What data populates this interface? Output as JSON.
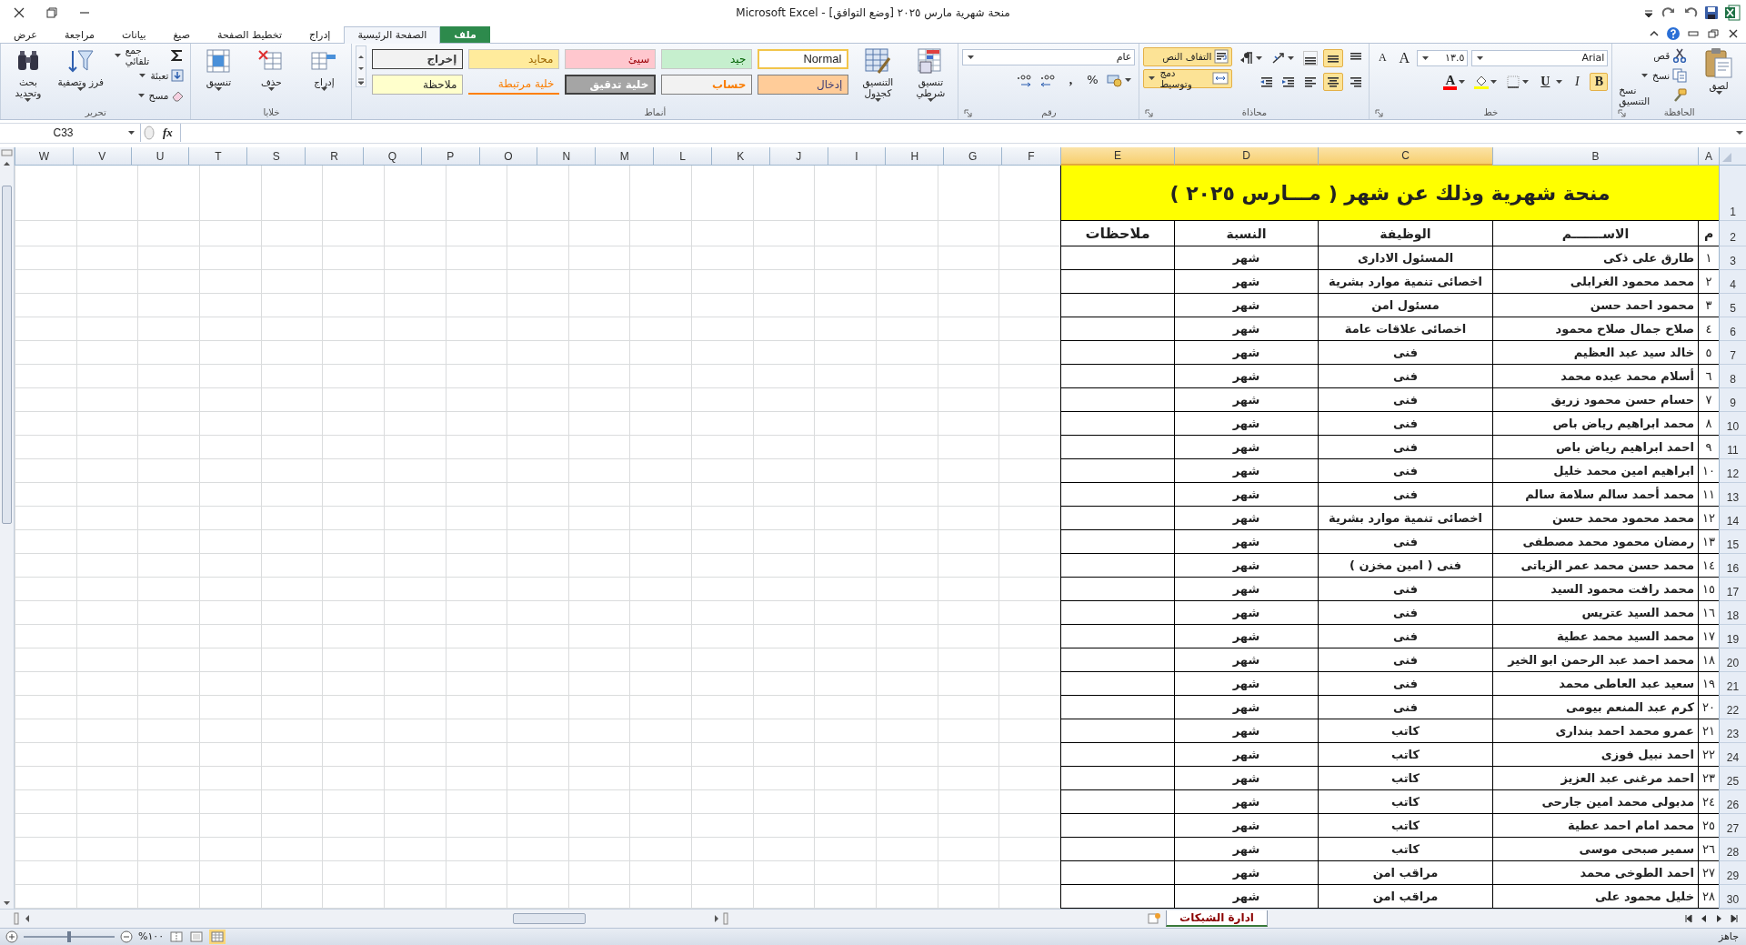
{
  "window": {
    "title": "منحة شهرية مارس ٢٠٢٥ [وضع التوافق] - Microsoft Excel"
  },
  "ribbon": {
    "tabs": [
      {
        "label": "ملف",
        "kind": "file",
        "selected": false
      },
      {
        "label": "الصفحة الرئيسية",
        "kind": "tab",
        "selected": true
      },
      {
        "label": "إدراج",
        "kind": "tab",
        "selected": false
      },
      {
        "label": "تخطيط الصفحة",
        "kind": "tab",
        "selected": false
      },
      {
        "label": "صيغ",
        "kind": "tab",
        "selected": false
      },
      {
        "label": "بيانات",
        "kind": "tab",
        "selected": false
      },
      {
        "label": "مراجعة",
        "kind": "tab",
        "selected": false
      },
      {
        "label": "عرض",
        "kind": "tab",
        "selected": false
      }
    ],
    "groups": [
      {
        "label": "الحافظة",
        "launcher": true,
        "items": [
          {
            "kind": "large",
            "label": "لصق",
            "dropdown": true
          },
          {
            "kind": "column",
            "items": [
              {
                "kind": "small",
                "label": "قص",
                "dropdown": false
              },
              {
                "kind": "small",
                "label": "نسخ",
                "dropdown": true
              },
              {
                "kind": "small",
                "label": "نسخ التنسيق",
                "dropdown": false
              }
            ]
          }
        ]
      },
      {
        "label": "خط",
        "launcher": true,
        "items": [
          {
            "kind": "toolbars",
            "bars": [
              {
                "items": [
                  {
                    "kind": "field",
                    "value": "Arial",
                    "dropdown": true
                  },
                  {
                    "kind": "field",
                    "value": "١٣.٥",
                    "dropdown": true
                  },
                  {
                    "kind": "grow",
                    "label": "A"
                  },
                  {
                    "kind": "shrink",
                    "label": "A"
                  }
                ]
              },
              {
                "items": [
                  {
                    "kind": "glyph",
                    "label": "B",
                    "selected": true
                  },
                  {
                    "kind": "glyph",
                    "label": "I",
                    "selected": false
                  },
                  {
                    "kind": "glyph",
                    "label": "U",
                    "selected": false,
                    "dropdown": true
                  },
                  {
                    "kind": "icon",
                    "selected": false,
                    "dropdown": true
                  },
                  {
                    "kind": "fill",
                    "color": "#ffff00",
                    "dropdown": true
                  },
                  {
                    "kind": "fontcolor",
                    "label": "A",
                    "color": "#ff0000",
                    "dropdown": true
                  }
                ]
              }
            ]
          }
        ]
      },
      {
        "label": "محاذاة",
        "launcher": true,
        "items": [
          {
            "kind": "toolbars",
            "bars": [
              {
                "items": [
                  {
                    "kind": "icon",
                    "selected": false
                  },
                  {
                    "kind": "icon",
                    "selected": true
                  },
                  {
                    "kind": "icon",
                    "selected": false
                  },
                  {
                    "kind": "icon",
                    "selected": false,
                    "dropdown": true
                  },
                  {
                    "kind": "icon",
                    "selected": false,
                    "dropdown": true
                  }
                ]
              },
              {
                "items": [
                  {
                    "kind": "icon",
                    "selected": false
                  },
                  {
                    "kind": "icon",
                    "selected": true
                  },
                  {
                    "kind": "icon",
                    "selected": false
                  },
                  {
                    "kind": "icon",
                    "selected": false
                  },
                  {
                    "kind": "icon",
                    "selected": false
                  }
                ]
              }
            ]
          },
          {
            "kind": "column",
            "items": [
              {
                "kind": "small",
                "label": "التفاف النص",
                "selected": true,
                "dropdown": false
              },
              {
                "kind": "small",
                "label": "دمج وتوسيط",
                "selected": true,
                "dropdown": true
              }
            ]
          }
        ]
      },
      {
        "label": "رقم",
        "launcher": true,
        "items": [
          {
            "kind": "toolbars",
            "bars": [
              {
                "items": [
                  {
                    "kind": "field",
                    "value": "عام",
                    "dropdown": true
                  }
                ]
              },
              {
                "items": [
                  {
                    "kind": "icon",
                    "selected": false,
                    "dropdown": true
                  },
                  {
                    "kind": "glyph",
                    "label": "%",
                    "selected": false
                  },
                  {
                    "kind": "glyph",
                    "label": ",",
                    "selected": false
                  },
                  {
                    "kind": "icon",
                    "selected": false
                  },
                  {
                    "kind": "icon",
                    "selected": false
                  }
                ]
              }
            ]
          }
        ]
      },
      {
        "label": "أنماط",
        "launcher": false,
        "items": [
          {
            "kind": "large",
            "label": "تنسيق شرطي",
            "dropdown": true
          },
          {
            "kind": "large",
            "label": "التنسيق كجدول",
            "dropdown": true
          },
          {
            "kind": "gallery",
            "items": [
              {
                "label": "Normal"
              },
              {
                "label": "جيد"
              },
              {
                "label": "سيئ"
              },
              {
                "label": "محايد"
              },
              {
                "label": "إخراج"
              },
              {
                "label": "إدخال"
              },
              {
                "label": "حساب"
              },
              {
                "label": "خلية تدقيق"
              },
              {
                "label": "خلية مرتبطة"
              },
              {
                "label": "ملاحظة"
              }
            ]
          }
        ]
      },
      {
        "label": "خلايا",
        "launcher": false,
        "items": [
          {
            "kind": "large",
            "label": "إدراج",
            "dropdown": true
          },
          {
            "kind": "large",
            "label": "حذف",
            "dropdown": true
          },
          {
            "kind": "large",
            "label": "تنسيق",
            "dropdown": true
          }
        ]
      },
      {
        "label": "تحرير",
        "launcher": false,
        "items": [
          {
            "kind": "column",
            "items": [
              {
                "kind": "small",
                "label": "جمع تلقائي",
                "dropdown": true
              },
              {
                "kind": "small",
                "label": "تعبئة",
                "dropdown": true
              },
              {
                "kind": "small",
                "label": "مسح",
                "dropdown": true
              }
            ]
          },
          {
            "kind": "large",
            "label": "فرز وتصفية",
            "dropdown": true
          },
          {
            "kind": "large",
            "label": "بحث وتحديد",
            "dropdown": true
          }
        ]
      }
    ]
  },
  "formula_bar": {
    "name_box": "C33",
    "function_label": "fx"
  },
  "sheet": {
    "columns": [
      {
        "label": "A",
        "selected": false
      },
      {
        "label": "B",
        "selected": false
      },
      {
        "label": "C",
        "selected": true
      },
      {
        "label": "D",
        "selected": true
      },
      {
        "label": "E",
        "selected": true
      },
      {
        "label": "F",
        "selected": false
      },
      {
        "label": "G",
        "selected": false
      },
      {
        "label": "H",
        "selected": false
      },
      {
        "label": "I",
        "selected": false
      },
      {
        "label": "J",
        "selected": false
      },
      {
        "label": "K",
        "selected": false
      },
      {
        "label": "L",
        "selected": false
      },
      {
        "label": "M",
        "selected": false
      },
      {
        "label": "N",
        "selected": false
      },
      {
        "label": "O",
        "selected": false
      },
      {
        "label": "P",
        "selected": false
      },
      {
        "label": "Q",
        "selected": false
      },
      {
        "label": "R",
        "selected": false
      },
      {
        "label": "S",
        "selected": false
      },
      {
        "label": "T",
        "selected": false
      },
      {
        "label": "U",
        "selected": false
      },
      {
        "label": "V",
        "selected": false
      },
      {
        "label": "W",
        "selected": false
      }
    ],
    "row_numbers": [
      "1",
      "2",
      "3",
      "4",
      "5",
      "6",
      "7",
      "8",
      "9",
      "10",
      "11",
      "12",
      "13",
      "14",
      "15",
      "16",
      "17",
      "18",
      "19",
      "20",
      "21",
      "22",
      "23",
      "24",
      "25",
      "26",
      "27",
      "28",
      "29",
      "30"
    ],
    "title": "منحة شهرية وذلك عن شهر ( مـــارس ٢٠٢٥ )",
    "headers": [
      "م",
      "الاســـــــم",
      "الوظيفة",
      "النسبة",
      "ملاحظات"
    ],
    "rows": [
      {
        "number": "١",
        "name": "طارق على ذكى",
        "job": "المسئول الادارى",
        "rate": "شهر"
      },
      {
        "number": "٢",
        "name": "محمد محمود الغرابلى",
        "job": "اخصائى تنمية موارد بشرية",
        "rate": "شهر"
      },
      {
        "number": "٣",
        "name": "محمود احمد حسن",
        "job": "مسئول امن",
        "rate": "شهر"
      },
      {
        "number": "٤",
        "name": "صلاح جمال صلاح محمود",
        "job": "اخصائى علاقات عامة",
        "rate": "شهر"
      },
      {
        "number": "٥",
        "name": "خالد سيد عبد العظيم",
        "job": "فنى",
        "rate": "شهر"
      },
      {
        "number": "٦",
        "name": "أسلام محمد عبده محمد",
        "job": "فنى",
        "rate": "شهر"
      },
      {
        "number": "٧",
        "name": "حسام حسن محمود زريق",
        "job": "فنى",
        "rate": "شهر"
      },
      {
        "number": "٨",
        "name": "محمد ابراهيم رياض باص",
        "job": "فنى",
        "rate": "شهر"
      },
      {
        "number": "٩",
        "name": "احمد ابراهيم رياض باص",
        "job": "فنى",
        "rate": "شهر"
      },
      {
        "number": "١٠",
        "name": "ابراهيم امين محمد خليل",
        "job": "فنى",
        "rate": "شهر"
      },
      {
        "number": "١١",
        "name": "محمد أحمد سالم سلامة سالم",
        "job": "فنى",
        "rate": "شهر"
      },
      {
        "number": "١٢",
        "name": "محمد محمود محمد حسن",
        "job": "اخصائى تنمية موارد بشرية",
        "rate": "شهر"
      },
      {
        "number": "١٣",
        "name": "رمضان محمود محمد مصطفى",
        "job": "فنى",
        "rate": "شهر"
      },
      {
        "number": "١٤",
        "name": "محمد حسن محمد عمر الزياتى",
        "job": "فنى ( امين مخزن )",
        "rate": "شهر"
      },
      {
        "number": "١٥",
        "name": "محمد رافت محمود السيد",
        "job": "فنى",
        "rate": "شهر"
      },
      {
        "number": "١٦",
        "name": "محمد السيد عتريس",
        "job": "فنى",
        "rate": "شهر"
      },
      {
        "number": "١٧",
        "name": "محمد السيد محمد عطية",
        "job": "فنى",
        "rate": "شهر"
      },
      {
        "number": "١٨",
        "name": "محمد احمد عبد الرحمن ابو الخير",
        "job": "فنى",
        "rate": "شهر"
      },
      {
        "number": "١٩",
        "name": "سعيد عبد العاطى محمد",
        "job": "فنى",
        "rate": "شهر"
      },
      {
        "number": "٢٠",
        "name": "كرم عبد المنعم بيومى",
        "job": "فنى",
        "rate": "شهر"
      },
      {
        "number": "٢١",
        "name": "عمرو محمد احمد بندارى",
        "job": "كاتب",
        "rate": "شهر"
      },
      {
        "number": "٢٢",
        "name": "احمد نبيل فوزى",
        "job": "كاتب",
        "rate": "شهر"
      },
      {
        "number": "٢٣",
        "name": "احمد مرغنى عبد العزيز",
        "job": "كاتب",
        "rate": "شهر"
      },
      {
        "number": "٢٤",
        "name": "مدبولى محمد امين جارحى",
        "job": "كاتب",
        "rate": "شهر"
      },
      {
        "number": "٢٥",
        "name": "محمد امام احمد عطية",
        "job": "كاتب",
        "rate": "شهر"
      },
      {
        "number": "٢٦",
        "name": "سمير صبحى موسى",
        "job": "كاتب",
        "rate": "شهر"
      },
      {
        "number": "٢٧",
        "name": "احمد الطوخى محمد",
        "job": "مراقب امن",
        "rate": "شهر"
      },
      {
        "number": "٢٨",
        "name": "خليل محمود على",
        "job": "مراقب امن",
        "rate": "شهر"
      }
    ]
  },
  "sheet_tabs": [
    {
      "label": "ادارة الشبكات",
      "selected": true
    }
  ],
  "status_bar": {
    "status": "جاهز",
    "zoom": {
      "label": "%١٠٠",
      "level": 0.5
    }
  }
}
